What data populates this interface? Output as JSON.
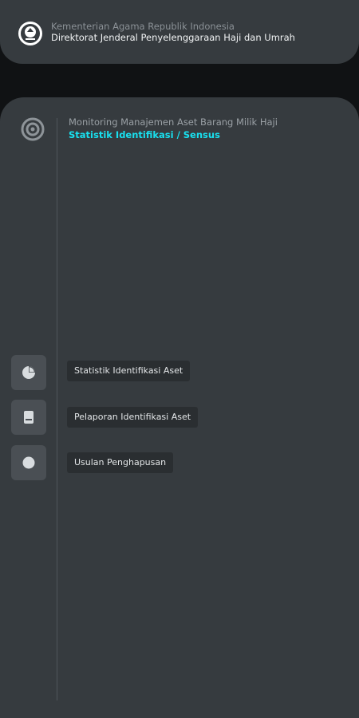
{
  "header": {
    "org": "Kementerian Agama Republik Indonesia",
    "dept": "Direktorat Jenderal Penyelenggaraan Haji dan Umrah",
    "logo_icon": "kemenag-emblem-icon"
  },
  "page": {
    "title": "Monitoring Manajemen Aset Barang Milik Haji",
    "subtitle": "Statistik Identifikasi / Sensus",
    "header_icon": "target-icon"
  },
  "menu": [
    {
      "label": "Statistik Identifikasi Aset",
      "icon": "pie-chart-icon"
    },
    {
      "label": "Pelaporan Identifikasi Aset",
      "icon": "document-icon"
    },
    {
      "label": "Usulan Penghapusan",
      "icon": "circle-icon"
    }
  ],
  "colors": {
    "accent": "#18e0ef",
    "panel": "#363b3f",
    "background": "#101214"
  }
}
